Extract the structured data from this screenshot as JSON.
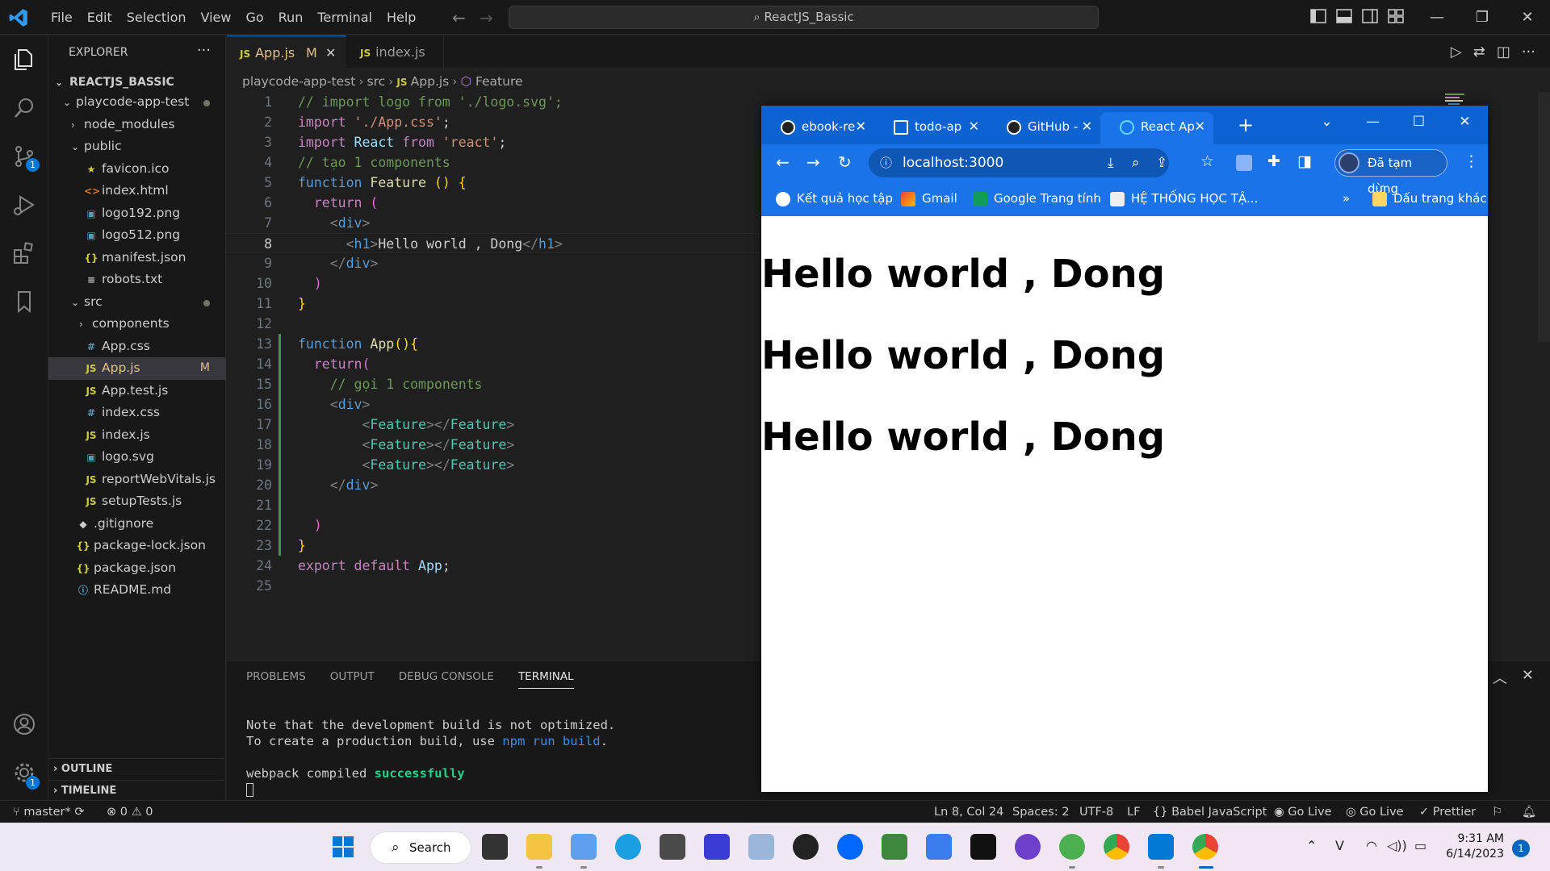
{
  "titlebar": {
    "menu": [
      "File",
      "Edit",
      "Selection",
      "View",
      "Go",
      "Run",
      "Terminal",
      "Help"
    ],
    "search": "ReactJS_Bassic"
  },
  "activity": {
    "scm_badge": "1",
    "settings_badge": "1"
  },
  "sidebar": {
    "title": "EXPLORER",
    "project": "REACTJS_BASSIC",
    "tree": [
      {
        "label": "playcode-app-test",
        "kind": "folder-open",
        "indent": 1,
        "dot": true
      },
      {
        "label": "node_modules",
        "kind": "folder",
        "indent": 2
      },
      {
        "label": "public",
        "kind": "folder-open",
        "indent": 2
      },
      {
        "label": "favicon.ico",
        "kind": "star",
        "indent": 3
      },
      {
        "label": "index.html",
        "kind": "html",
        "indent": 3
      },
      {
        "label": "logo192.png",
        "kind": "img",
        "indent": 3
      },
      {
        "label": "logo512.png",
        "kind": "img",
        "indent": 3
      },
      {
        "label": "manifest.json",
        "kind": "json",
        "indent": 3
      },
      {
        "label": "robots.txt",
        "kind": "txt",
        "indent": 3
      },
      {
        "label": "src",
        "kind": "folder-open",
        "indent": 2,
        "dot": true
      },
      {
        "label": "components",
        "kind": "folder",
        "indent": 3
      },
      {
        "label": "App.css",
        "kind": "css",
        "indent": 3
      },
      {
        "label": "App.js",
        "kind": "js",
        "indent": 3,
        "selected": true,
        "mod": "M"
      },
      {
        "label": "App.test.js",
        "kind": "js",
        "indent": 3
      },
      {
        "label": "index.css",
        "kind": "css",
        "indent": 3
      },
      {
        "label": "index.js",
        "kind": "js",
        "indent": 3
      },
      {
        "label": "logo.svg",
        "kind": "img",
        "indent": 3
      },
      {
        "label": "reportWebVitals.js",
        "kind": "js",
        "indent": 3
      },
      {
        "label": "setupTests.js",
        "kind": "js",
        "indent": 3
      },
      {
        "label": ".gitignore",
        "kind": "git",
        "indent": 2
      },
      {
        "label": "package-lock.json",
        "kind": "json",
        "indent": 2
      },
      {
        "label": "package.json",
        "kind": "json",
        "indent": 2
      },
      {
        "label": "README.md",
        "kind": "info",
        "indent": 2
      }
    ],
    "outline": "OUTLINE",
    "timeline": "TIMELINE"
  },
  "editor": {
    "tabs": [
      {
        "label": "App.js",
        "mod": "M"
      },
      {
        "label": "index.js"
      }
    ],
    "breadcrumb": [
      "playcode-app-test",
      "src",
      "App.js",
      "Feature"
    ],
    "current_line": 8
  },
  "panel": {
    "tabs": [
      "PROBLEMS",
      "OUTPUT",
      "DEBUG CONSOLE",
      "TERMINAL"
    ],
    "active_tab": "TERMINAL",
    "terminal": {
      "line1": "Note that the development build is not optimized.",
      "line2a": "To create a production build, use ",
      "line2b": "npm run build",
      "line2c": ".",
      "line3a": "webpack compiled ",
      "line3b": "successfully"
    }
  },
  "statusbar": {
    "branch": "master*",
    "errors": "0",
    "warnings": "0",
    "position": "Ln 8, Col 24",
    "spaces": "Spaces: 2",
    "encoding": "UTF-8",
    "eol": "LF",
    "language": "Babel JavaScript",
    "golive1": "Go Live",
    "golive2": "Go Live",
    "prettier": "Prettier"
  },
  "chrome": {
    "tabs": [
      "ebook-re",
      "todo-ap",
      "GitHub -",
      "React Ap"
    ],
    "url": "localhost:3000",
    "profile": "Đã tạm dừng",
    "bookmarks": [
      "Kết quả học tập",
      "Gmail",
      "Google Trang tính",
      "HỆ THỐNG HỌC TẬ...",
      "Dấu trang khác"
    ],
    "headings": [
      "Hello world , Dong",
      "Hello world , Dong",
      "Hello world , Dong"
    ]
  },
  "taskbar": {
    "search": "Search",
    "time": "9:31 AM",
    "date": "6/14/2023",
    "notifications": "1"
  },
  "colors": {
    "editor_bg": "#1f1f1f",
    "sidebar_bg": "#181818",
    "accent": "#0078d4",
    "chrome_blue": "#1a73e8"
  }
}
